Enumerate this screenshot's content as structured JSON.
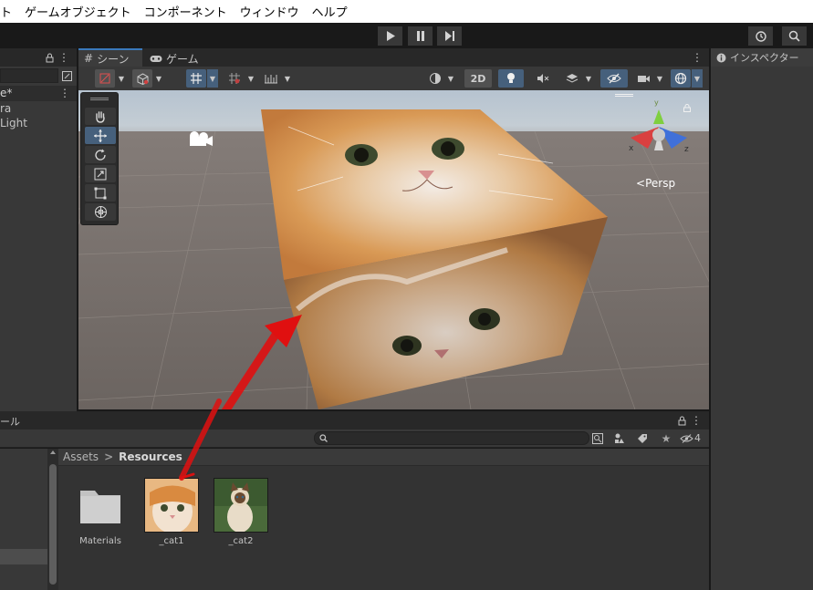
{
  "menu": {
    "items": [
      "ト",
      "ゲームオブジェクト",
      "コンポーネント",
      "ウィンドウ",
      "ヘルプ"
    ]
  },
  "hierarchy": {
    "scene_label": "e*",
    "items": [
      "ra",
      "Light"
    ]
  },
  "scene_view": {
    "tabs": {
      "scene": "シーン",
      "game": "ゲーム"
    },
    "toolbar": {
      "mode_2d": "2D"
    },
    "gizmo": {
      "projection": "Persp",
      "axis_x": "x",
      "axis_z": "z",
      "axis_y": "y"
    }
  },
  "inspector": {
    "title": "インスペクター"
  },
  "project": {
    "tab_fragment": "ール",
    "breadcrumb": {
      "root": "Assets",
      "separator": ">",
      "current": "Resources"
    },
    "hidden_count": "4",
    "assets": [
      {
        "name": "Materials",
        "kind": "folder"
      },
      {
        "name": "_cat1",
        "kind": "texture"
      },
      {
        "name": "_cat2",
        "kind": "texture"
      }
    ]
  },
  "colors": {
    "active_blue": "#46607c",
    "annotation_arrow": "#e01010",
    "panel": "#383838",
    "menu_bg": "#ffffff"
  }
}
